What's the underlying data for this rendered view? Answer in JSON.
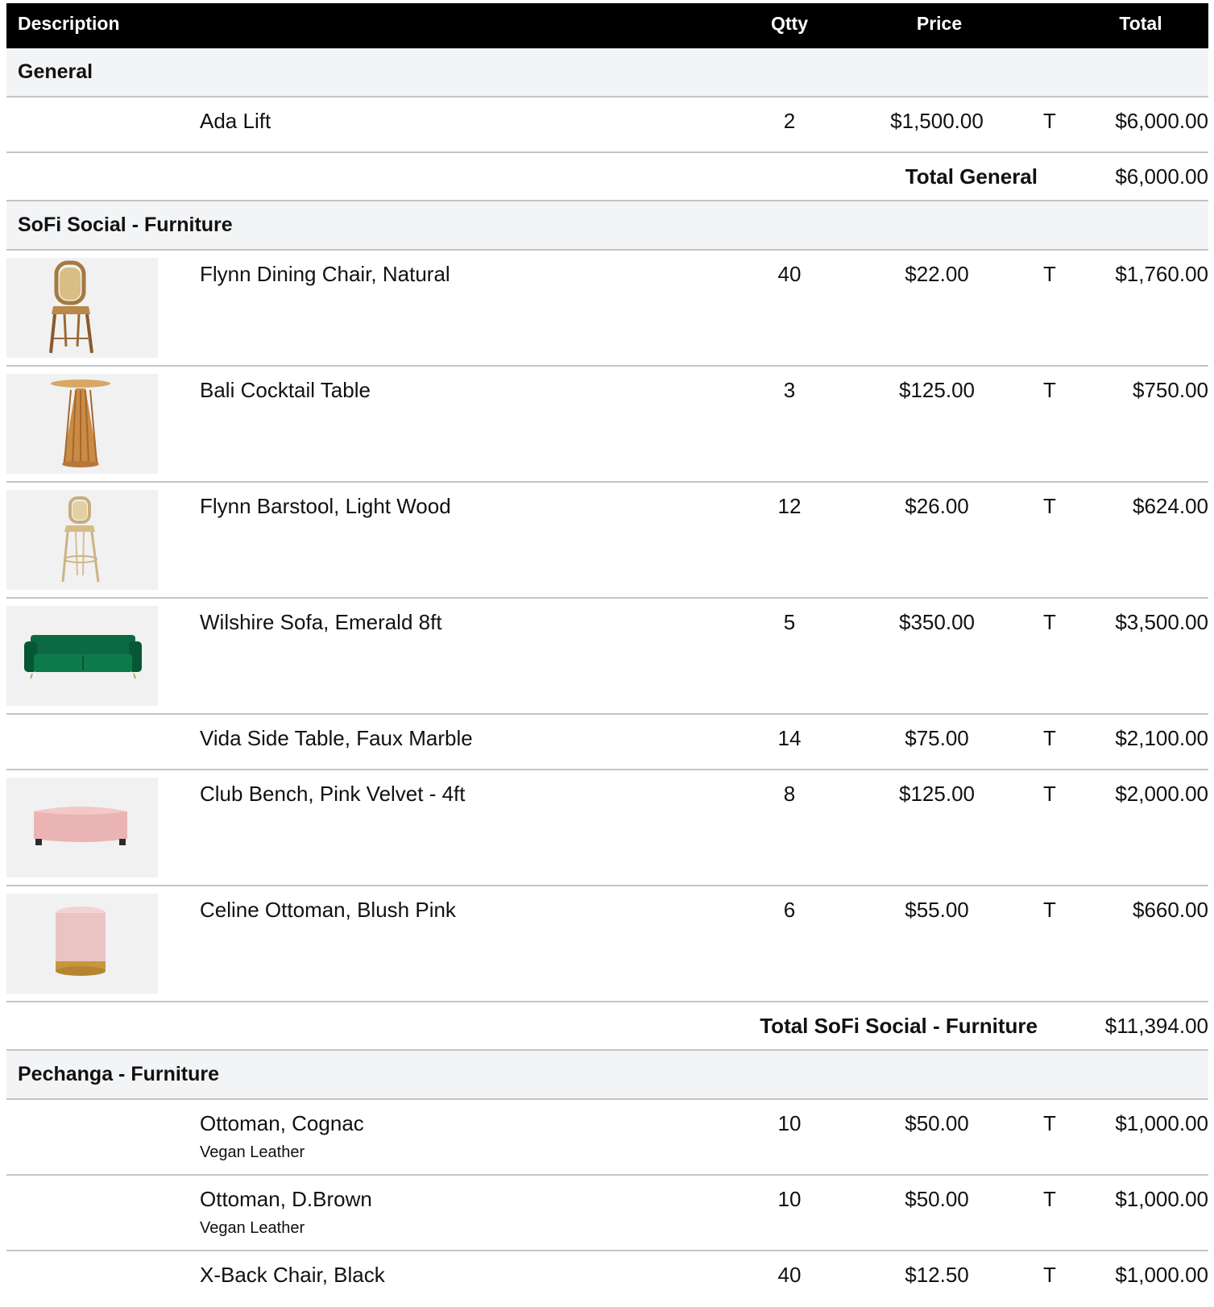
{
  "header": {
    "description": "Description",
    "qty": "Qtty",
    "price": "Price",
    "total": "Total"
  },
  "sections": [
    {
      "title": "General",
      "items": [
        {
          "description": "Ada Lift",
          "qty": "2",
          "price": "$1,500.00",
          "tax": "T",
          "total": "$6,000.00"
        }
      ],
      "total_label": "Total General",
      "total_value": "$6,000.00"
    },
    {
      "title": "SoFi Social - Furniture",
      "items": [
        {
          "description": "Flynn Dining Chair, Natural",
          "qty": "40",
          "price": "$22.00",
          "tax": "T",
          "total": "$1,760.00",
          "image": "dining-chair"
        },
        {
          "description": "Bali Cocktail Table",
          "qty": "3",
          "price": "$125.00",
          "tax": "T",
          "total": "$750.00",
          "image": "cocktail-table"
        },
        {
          "description": "Flynn Barstool, Light Wood",
          "qty": "12",
          "price": "$26.00",
          "tax": "T",
          "total": "$624.00",
          "image": "barstool"
        },
        {
          "description": "Wilshire Sofa, Emerald 8ft",
          "qty": "5",
          "price": "$350.00",
          "tax": "T",
          "total": "$3,500.00",
          "image": "sofa"
        },
        {
          "description": "Vida Side Table, Faux Marble",
          "qty": "14",
          "price": "$75.00",
          "tax": "T",
          "total": "$2,100.00"
        },
        {
          "description": "Club Bench, Pink Velvet - 4ft",
          "qty": "8",
          "price": "$125.00",
          "tax": "T",
          "total": "$2,000.00",
          "image": "bench"
        },
        {
          "description": "Celine Ottoman, Blush Pink",
          "qty": "6",
          "price": "$55.00",
          "tax": "T",
          "total": "$660.00",
          "image": "ottoman"
        }
      ],
      "total_label": "Total SoFi Social - Furniture",
      "total_value": "$11,394.00"
    },
    {
      "title": "Pechanga - Furniture",
      "items": [
        {
          "description": "Ottoman, Cognac",
          "subdescription": "Vegan Leather",
          "qty": "10",
          "price": "$50.00",
          "tax": "T",
          "total": "$1,000.00"
        },
        {
          "description": "Ottoman, D.Brown",
          "subdescription": "Vegan Leather",
          "qty": "10",
          "price": "$50.00",
          "tax": "T",
          "total": "$1,000.00"
        },
        {
          "description": "X-Back Chair, Black",
          "qty": "40",
          "price": "$12.50",
          "tax": "T",
          "total": "$1,000.00"
        }
      ]
    }
  ]
}
